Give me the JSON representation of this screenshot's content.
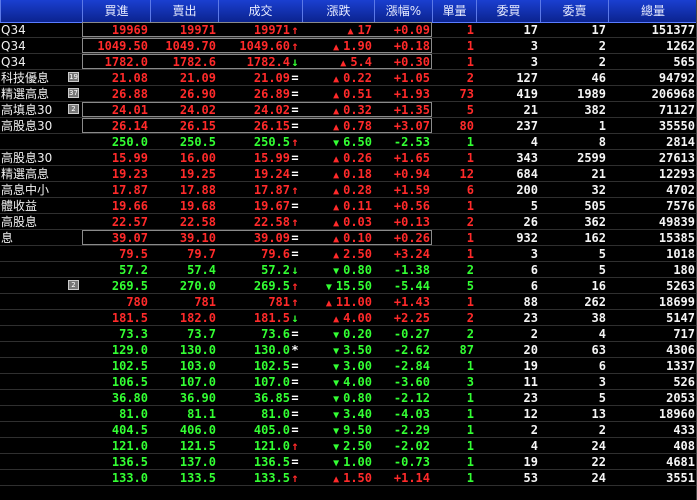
{
  "headers": [
    "",
    "買進",
    "賣出",
    "成交",
    "漲跌",
    "漲幅%",
    "單量",
    "委買",
    "委賣",
    "總量"
  ],
  "rows": [
    {
      "name": "Q34",
      "bid": "19969",
      "ask": "19971",
      "last": "19971",
      "lastSym": "↑",
      "chg": "17",
      "chgDir": "up",
      "pct": "+0.09",
      "vol": "1",
      "buyQ": "17",
      "sellQ": "17",
      "total": "151377",
      "c": "red",
      "icon": ""
    },
    {
      "name": "Q34",
      "bid": "1049.50",
      "ask": "1049.70",
      "last": "1049.60",
      "lastSym": "↑",
      "chg": "1.90",
      "chgDir": "up",
      "pct": "+0.18",
      "vol": "1",
      "buyQ": "3",
      "sellQ": "2",
      "total": "1262",
      "c": "red",
      "icon": ""
    },
    {
      "name": "Q34",
      "bid": "1782.0",
      "ask": "1782.6",
      "last": "1782.4",
      "lastSym": "↓",
      "chg": "5.4",
      "chgDir": "up",
      "pct": "+0.30",
      "vol": "1",
      "buyQ": "3",
      "sellQ": "2",
      "total": "565",
      "c": "red",
      "icon": ""
    },
    {
      "name": "科技優息",
      "bid": "21.08",
      "ask": "21.09",
      "last": "21.09",
      "lastSym": "=",
      "chg": "0.22",
      "chgDir": "up",
      "pct": "+1.05",
      "vol": "2",
      "buyQ": "127",
      "sellQ": "46",
      "total": "94792",
      "c": "red",
      "icon": "19"
    },
    {
      "name": "精選高息",
      "bid": "26.88",
      "ask": "26.90",
      "last": "26.89",
      "lastSym": "=",
      "chg": "0.51",
      "chgDir": "up",
      "pct": "+1.93",
      "vol": "73",
      "buyQ": "419",
      "sellQ": "1989",
      "total": "206968",
      "c": "red",
      "icon": "37"
    },
    {
      "name": "高填息30",
      "bid": "24.01",
      "ask": "24.02",
      "last": "24.02",
      "lastSym": "=",
      "chg": "0.32",
      "chgDir": "up",
      "pct": "+1.35",
      "vol": "5",
      "buyQ": "21",
      "sellQ": "382",
      "total": "71127",
      "c": "red",
      "icon": "2"
    },
    {
      "name": "高股息30",
      "bid": "26.14",
      "ask": "26.15",
      "last": "26.15",
      "lastSym": "=",
      "chg": "0.78",
      "chgDir": "up",
      "pct": "+3.07",
      "vol": "80",
      "buyQ": "237",
      "sellQ": "1",
      "total": "35550",
      "c": "red",
      "icon": ""
    },
    {
      "name": "",
      "bid": "250.0",
      "ask": "250.5",
      "last": "250.5",
      "lastSym": "↑",
      "chg": "6.50",
      "chgDir": "down",
      "pct": "-2.53",
      "vol": "1",
      "buyQ": "4",
      "sellQ": "8",
      "total": "2814",
      "c": "grn",
      "icon": ""
    },
    {
      "name": "高股息30",
      "bid": "15.99",
      "ask": "16.00",
      "last": "15.99",
      "lastSym": "=",
      "chg": "0.26",
      "chgDir": "up",
      "pct": "+1.65",
      "vol": "1",
      "buyQ": "343",
      "sellQ": "2599",
      "total": "27613",
      "c": "red",
      "icon": ""
    },
    {
      "name": "精選高息",
      "bid": "19.23",
      "ask": "19.25",
      "last": "19.24",
      "lastSym": "=",
      "chg": "0.18",
      "chgDir": "up",
      "pct": "+0.94",
      "vol": "12",
      "buyQ": "684",
      "sellQ": "21",
      "total": "12293",
      "c": "red",
      "icon": ""
    },
    {
      "name": "高息中小",
      "bid": "17.87",
      "ask": "17.88",
      "last": "17.87",
      "lastSym": "↑",
      "chg": "0.28",
      "chgDir": "up",
      "pct": "+1.59",
      "vol": "6",
      "buyQ": "200",
      "sellQ": "32",
      "total": "4702",
      "c": "red",
      "icon": ""
    },
    {
      "name": "體收益",
      "bid": "19.66",
      "ask": "19.68",
      "last": "19.67",
      "lastSym": "=",
      "chg": "0.11",
      "chgDir": "up",
      "pct": "+0.56",
      "vol": "1",
      "buyQ": "5",
      "sellQ": "505",
      "total": "7576",
      "c": "red",
      "icon": ""
    },
    {
      "name": "高股息",
      "bid": "22.57",
      "ask": "22.58",
      "last": "22.58",
      "lastSym": "↑",
      "chg": "0.03",
      "chgDir": "up",
      "pct": "+0.13",
      "vol": "2",
      "buyQ": "26",
      "sellQ": "362",
      "total": "49839",
      "c": "red",
      "icon": ""
    },
    {
      "name": "息",
      "bid": "39.07",
      "ask": "39.10",
      "last": "39.09",
      "lastSym": "=",
      "chg": "0.10",
      "chgDir": "up",
      "pct": "+0.26",
      "vol": "1",
      "buyQ": "932",
      "sellQ": "162",
      "total": "15385",
      "c": "red",
      "icon": ""
    },
    {
      "name": "",
      "bid": "79.5",
      "ask": "79.7",
      "last": "79.6",
      "lastSym": "=",
      "chg": "2.50",
      "chgDir": "up",
      "pct": "+3.24",
      "vol": "1",
      "buyQ": "3",
      "sellQ": "5",
      "total": "1018",
      "c": "red",
      "icon": ""
    },
    {
      "name": "",
      "bid": "57.2",
      "ask": "57.4",
      "last": "57.2",
      "lastSym": "↓",
      "chg": "0.80",
      "chgDir": "down",
      "pct": "-1.38",
      "vol": "2",
      "buyQ": "6",
      "sellQ": "5",
      "total": "180",
      "c": "grn",
      "icon": ""
    },
    {
      "name": "",
      "bid": "269.5",
      "ask": "270.0",
      "last": "269.5",
      "lastSym": "↑",
      "chg": "15.50",
      "chgDir": "down",
      "pct": "-5.44",
      "vol": "5",
      "buyQ": "6",
      "sellQ": "16",
      "total": "5263",
      "c": "grn",
      "icon": "2"
    },
    {
      "name": "",
      "bid": "780",
      "ask": "781",
      "last": "781",
      "lastSym": "↑",
      "chg": "11.00",
      "chgDir": "up",
      "pct": "+1.43",
      "vol": "1",
      "buyQ": "88",
      "sellQ": "262",
      "total": "18699",
      "c": "red",
      "icon": ""
    },
    {
      "name": "",
      "bid": "181.5",
      "ask": "182.0",
      "last": "181.5",
      "lastSym": "↓",
      "chg": "4.00",
      "chgDir": "up",
      "pct": "+2.25",
      "vol": "2",
      "buyQ": "23",
      "sellQ": "38",
      "total": "5147",
      "c": "red",
      "icon": ""
    },
    {
      "name": "",
      "bid": "73.3",
      "ask": "73.7",
      "last": "73.6",
      "lastSym": "=",
      "chg": "0.20",
      "chgDir": "down",
      "pct": "-0.27",
      "vol": "2",
      "buyQ": "2",
      "sellQ": "4",
      "total": "717",
      "c": "grn",
      "icon": ""
    },
    {
      "name": "",
      "bid": "129.0",
      "ask": "130.0",
      "last": "130.0",
      "lastSym": "*",
      "chg": "3.50",
      "chgDir": "down",
      "pct": "-2.62",
      "vol": "87",
      "buyQ": "20",
      "sellQ": "63",
      "total": "4306",
      "c": "grn",
      "icon": ""
    },
    {
      "name": "",
      "bid": "102.5",
      "ask": "103.0",
      "last": "102.5",
      "lastSym": "=",
      "chg": "3.00",
      "chgDir": "down",
      "pct": "-2.84",
      "vol": "1",
      "buyQ": "19",
      "sellQ": "6",
      "total": "1337",
      "c": "grn",
      "icon": ""
    },
    {
      "name": "",
      "bid": "106.5",
      "ask": "107.0",
      "last": "107.0",
      "lastSym": "=",
      "chg": "4.00",
      "chgDir": "down",
      "pct": "-3.60",
      "vol": "3",
      "buyQ": "11",
      "sellQ": "3",
      "total": "526",
      "c": "grn",
      "icon": ""
    },
    {
      "name": "",
      "bid": "36.80",
      "ask": "36.90",
      "last": "36.85",
      "lastSym": "=",
      "chg": "0.80",
      "chgDir": "down",
      "pct": "-2.12",
      "vol": "1",
      "buyQ": "23",
      "sellQ": "5",
      "total": "2053",
      "c": "grn",
      "icon": ""
    },
    {
      "name": "",
      "bid": "81.0",
      "ask": "81.1",
      "last": "81.0",
      "lastSym": "=",
      "chg": "3.40",
      "chgDir": "down",
      "pct": "-4.03",
      "vol": "1",
      "buyQ": "12",
      "sellQ": "13",
      "total": "18960",
      "c": "grn",
      "icon": ""
    },
    {
      "name": "",
      "bid": "404.5",
      "ask": "406.0",
      "last": "405.0",
      "lastSym": "=",
      "chg": "9.50",
      "chgDir": "down",
      "pct": "-2.29",
      "vol": "1",
      "buyQ": "2",
      "sellQ": "2",
      "total": "433",
      "c": "grn",
      "icon": ""
    },
    {
      "name": "",
      "bid": "121.0",
      "ask": "121.5",
      "last": "121.0",
      "lastSym": "↑",
      "chg": "2.50",
      "chgDir": "down",
      "pct": "-2.02",
      "vol": "1",
      "buyQ": "4",
      "sellQ": "24",
      "total": "408",
      "c": "grn",
      "icon": ""
    },
    {
      "name": "",
      "bid": "136.5",
      "ask": "137.0",
      "last": "136.5",
      "lastSym": "=",
      "chg": "1.00",
      "chgDir": "down",
      "pct": "-0.73",
      "vol": "1",
      "buyQ": "19",
      "sellQ": "22",
      "total": "4681",
      "c": "grn",
      "icon": ""
    },
    {
      "name": "",
      "bid": "133.0",
      "ask": "133.5",
      "last": "133.5",
      "lastSym": "↑",
      "chg": "1.50",
      "chgDir": "up",
      "pct": "+1.14",
      "vol": "1",
      "buyQ": "53",
      "sellQ": "24",
      "total": "3551",
      "c": "grn",
      "icon": ""
    }
  ],
  "colors": {
    "up": "#ff2a2a",
    "down": "#33ff33",
    "neutral": "#f5f5f5",
    "header": "#1a3fd0"
  }
}
